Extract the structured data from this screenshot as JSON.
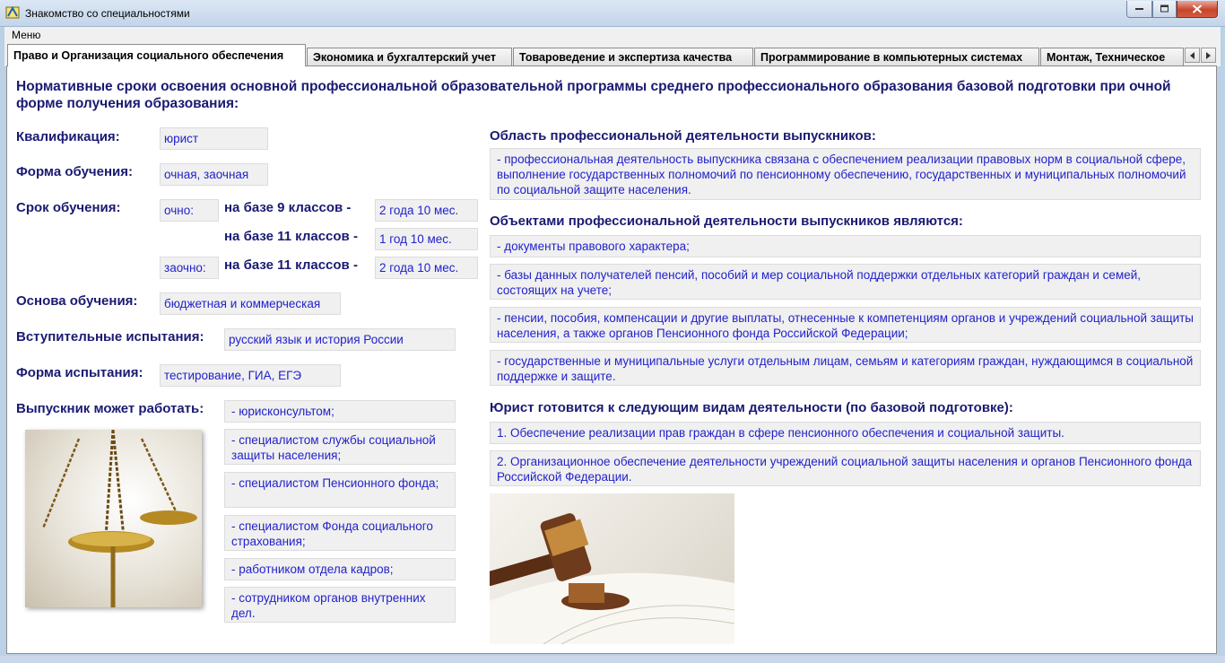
{
  "window": {
    "title": "Знакомство со специальностями",
    "minimize_icon": "minimize-icon",
    "maximize_icon": "maximize-icon",
    "close_icon": "close-icon"
  },
  "menu": {
    "items": [
      {
        "label": "Меню"
      }
    ]
  },
  "tabs": [
    {
      "label": "Право и Организация социального обеспечения",
      "active": true
    },
    {
      "label": "Экономика и бухгалтерский учет"
    },
    {
      "label": "Товароведение и экспертиза качества"
    },
    {
      "label": "Программирование в компьютерных системах"
    },
    {
      "label": "Монтаж, Техническое"
    }
  ],
  "content": {
    "heading": "Нормативные сроки освоения основной профессиональной образовательной программы среднего профессионального образования базовой подготовки при очной форме получения образования:",
    "qualification": {
      "label": "Квалификация:",
      "value": "юрист"
    },
    "study_form": {
      "label": "Форма обучения:",
      "value": "очная, заочная"
    },
    "study_term": {
      "label": "Срок обучения:",
      "full_time_label": "очно:",
      "part_time_label": "заочно:",
      "rows": [
        {
          "basis": "на базе 9 классов -",
          "value": "2 года 10 мес."
        },
        {
          "basis": "на базе 11 классов -",
          "value": "1 год 10 мес."
        },
        {
          "basis": "на базе 11 классов -",
          "value": "2 года 10 мес."
        }
      ]
    },
    "study_basis": {
      "label": "Основа обучения:",
      "value": "бюджетная и коммерческая"
    },
    "entrance_exams": {
      "label": "Вступительные испытания:",
      "value": "русский язык и история России"
    },
    "exam_form": {
      "label": "Форма испытания:",
      "value": "тестирование, ГИА, ЕГЭ"
    },
    "graduate_jobs": {
      "label": "Выпускник может работать:",
      "items": [
        "- юрисконсультом;",
        "- специалистом службы социальной защиты населения;",
        "- специалистом Пенсионного фонда;",
        "- специалистом Фонда социального страхования;",
        "- работником отдела кадров;",
        "- сотрудником органов внутренних дел."
      ]
    },
    "activity_area": {
      "title": "Область профессиональной деятельности выпускников:",
      "text": "- профессиональная деятельность выпускника связана с обеспечением реализации правовых норм в социальной сфере, выполнение государственных полномочий по пенсионному обеспечению, государственных и муниципальных полномочий по социальной защите населения."
    },
    "activity_objects": {
      "title": "Объектами профессиональной деятельности выпускников являются:",
      "items": [
        "- документы правового характера;",
        "- базы данных получателей пенсий, пособий и мер социальной поддержки отдельных категорий граждан и семей, состоящих на учете;",
        "- пенсии, пособия, компенсации и другие выплаты, отнесенные к компетенциям органов и учреждений социальной защиты населения, а также органов Пенсионного фонда Российской Федерации;",
        "- государственные и муниципальные услуги отдельным лицам, семьям и категориям граждан, нуждающимся в социальной поддержке и защите."
      ]
    },
    "activity_types": {
      "title": "Юрист готовится к следующим видам деятельности (по базовой подготовке):",
      "items": [
        "1. Обеспечение реализации прав граждан в сфере пенсионного обеспечения и социальной защиты.",
        "2. Организационное обеспечение деятельности учреждений социальной защиты населения и органов Пенсионного фонда Российской Федерации."
      ]
    },
    "images": {
      "scales": "scales-image",
      "gavel": "gavel-image"
    }
  }
}
